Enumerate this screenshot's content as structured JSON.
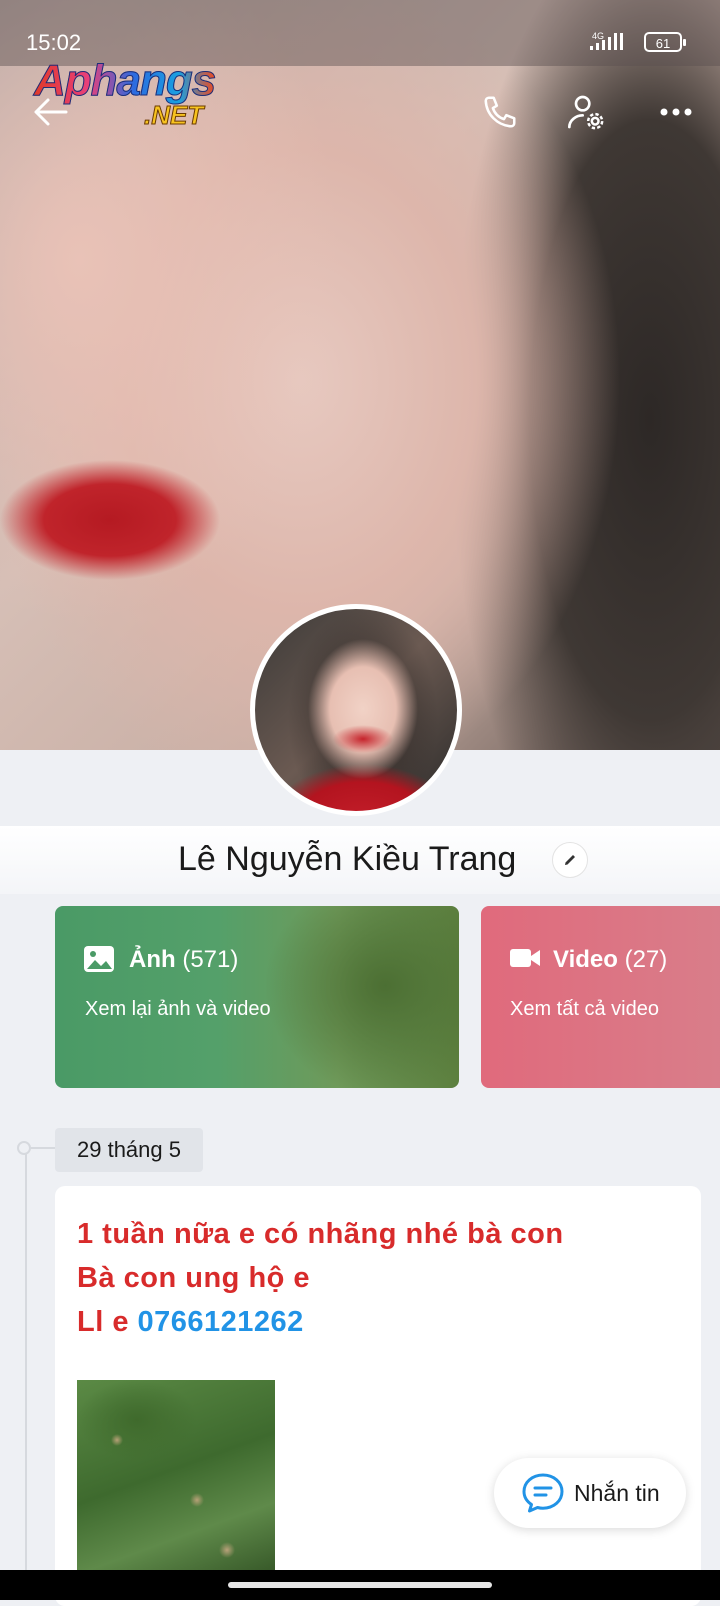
{
  "status_bar": {
    "time": "15:02",
    "network": "4G",
    "battery": "61"
  },
  "watermark": {
    "main": "Aphangs",
    "sub": ".NET"
  },
  "header": {
    "icons": [
      "back-arrow-icon",
      "phone-icon",
      "user-settings-icon",
      "more-icon"
    ]
  },
  "profile": {
    "name": "Lê Nguyễn Kiều Trang"
  },
  "cards": {
    "photos": {
      "title": "Ảnh",
      "count": "(571)",
      "subtitle": "Xem lại ảnh và video",
      "color": "#4a9a66"
    },
    "videos": {
      "title": "Video",
      "count": "(27)",
      "subtitle": "Xem tất cả video",
      "color": "#e06a7c"
    }
  },
  "timeline": {
    "date": "29 tháng 5",
    "post": {
      "line1": "1 tuần nữa e có nhãng nhé bà con",
      "line2": "Bà con ung hộ e",
      "line3_prefix": "Ll e",
      "phone": "0766121262"
    }
  },
  "fab": {
    "label": "Nhắn tin"
  },
  "colors": {
    "accent": "#2193e6",
    "post_text": "#d82b2b"
  }
}
